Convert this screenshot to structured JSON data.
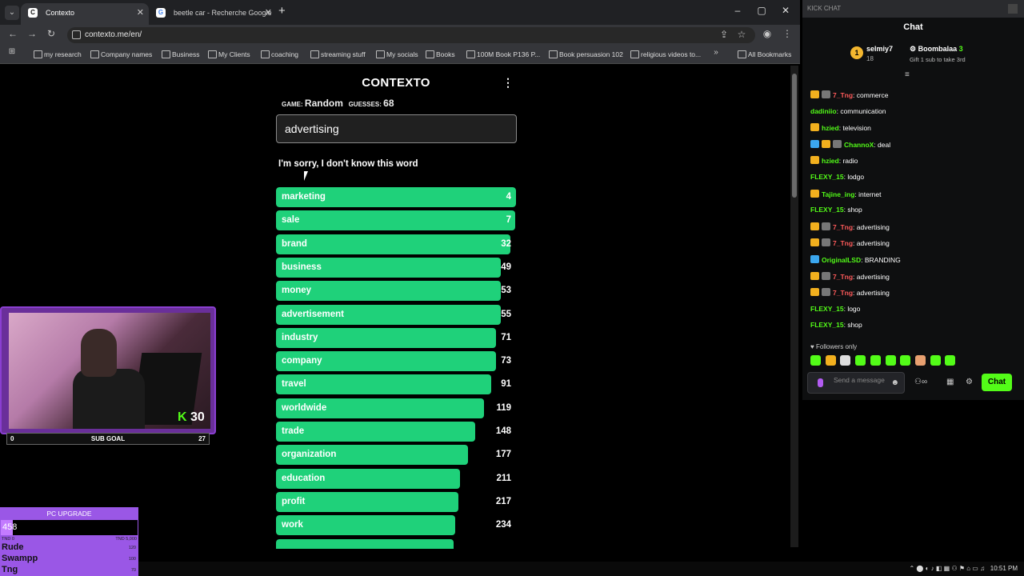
{
  "browser": {
    "tabs": [
      {
        "label": "Contexto",
        "active": true
      },
      {
        "label": "beetle car - Recherche Google",
        "active": false
      }
    ],
    "url": "contexto.me/en/",
    "bookmarks": [
      "my research",
      "Company names",
      "Business",
      "My Clients",
      "coaching",
      "streaming stuff",
      "My socials",
      "Books",
      "100M Book P136 P...",
      "Book persuasion 102",
      "religious videos to...",
      "All Bookmarks"
    ],
    "bookmarks_more": "»"
  },
  "contexto": {
    "title": "CONTEXTO",
    "game_label": "GAME:",
    "game_value": "Random",
    "guesses_label": "GUESSES:",
    "guesses_value": "68",
    "input_value": "advertising",
    "message": "I'm sorry, I don't know this word",
    "guesses": [
      {
        "word": "marketing",
        "rank": "4",
        "fill": 1.0
      },
      {
        "word": "sale",
        "rank": "7",
        "fill": 0.995
      },
      {
        "word": "brand",
        "rank": "32",
        "fill": 0.975
      },
      {
        "word": "business",
        "rank": "49",
        "fill": 0.935
      },
      {
        "word": "money",
        "rank": "53",
        "fill": 0.935
      },
      {
        "word": "advertisement",
        "rank": "55",
        "fill": 0.935
      },
      {
        "word": "industry",
        "rank": "71",
        "fill": 0.915
      },
      {
        "word": "company",
        "rank": "73",
        "fill": 0.915
      },
      {
        "word": "travel",
        "rank": "91",
        "fill": 0.895
      },
      {
        "word": "worldwide",
        "rank": "119",
        "fill": 0.865
      },
      {
        "word": "trade",
        "rank": "148",
        "fill": 0.83
      },
      {
        "word": "organization",
        "rank": "177",
        "fill": 0.8
      },
      {
        "word": "education",
        "rank": "211",
        "fill": 0.765
      },
      {
        "word": "profit",
        "rank": "217",
        "fill": 0.76
      },
      {
        "word": "work",
        "rank": "234",
        "fill": 0.745
      },
      {
        "word": "",
        "rank": "",
        "fill": 0.74
      }
    ]
  },
  "chat": {
    "window_label": "KICK CHAT",
    "title": "Chat",
    "pinned": {
      "user": "selmiy7",
      "count": "18",
      "gifter": "Boombalaa",
      "gift_count": "3",
      "gift_text": "Gift 1 sub to take 3rd"
    },
    "messages": [
      {
        "name": "7_Tng",
        "text": "commerce",
        "color": "#ff5a5a",
        "badges": [
          "gold",
          "grey"
        ]
      },
      {
        "name": "dadiniio",
        "text": "communication",
        "color": "#53fc18",
        "badges": []
      },
      {
        "name": "hzied",
        "text": "television",
        "color": "#53fc18",
        "badges": [
          "gold"
        ]
      },
      {
        "name": "ChannoX",
        "text": "deal",
        "color": "#53fc18",
        "badges": [
          "blue",
          "gold",
          "grey"
        ]
      },
      {
        "name": "hzied",
        "text": "radio",
        "color": "#53fc18",
        "badges": [
          "gold"
        ]
      },
      {
        "name": "FLEXY_15",
        "text": "lodgo",
        "color": "#53fc18",
        "badges": []
      },
      {
        "name": "Tajine_ing",
        "text": "internet",
        "color": "#53fc18",
        "badges": [
          "gold"
        ]
      },
      {
        "name": "FLEXY_15",
        "text": "shop",
        "color": "#53fc18",
        "badges": []
      },
      {
        "name": "7_Tng",
        "text": "advertising",
        "color": "#ff5a5a",
        "badges": [
          "gold",
          "grey"
        ]
      },
      {
        "name": "7_Tng",
        "text": "advertising",
        "color": "#ff5a5a",
        "badges": [
          "gold",
          "grey"
        ]
      },
      {
        "name": "OriginalLSD",
        "text": "BRANDING",
        "color": "#53fc18",
        "badges": [
          "blue"
        ]
      },
      {
        "name": "7_Tng",
        "text": "advertising",
        "color": "#ff5a5a",
        "badges": [
          "gold",
          "grey"
        ]
      },
      {
        "name": "7_Tng",
        "text": "advertising",
        "color": "#ff5a5a",
        "badges": [
          "gold",
          "grey"
        ]
      },
      {
        "name": "FLEXY_15",
        "text": "logo",
        "color": "#53fc18",
        "badges": []
      },
      {
        "name": "FLEXY_15",
        "text": "shop",
        "color": "#53fc18",
        "badges": []
      }
    ],
    "followers_only": "Followers only",
    "input_placeholder": "Send a message",
    "send_label": "Chat"
  },
  "stream": {
    "sub_goal_label": "SUB GOAL",
    "sub_goal_current": "0",
    "sub_goal_target": "27",
    "kick_count": "30",
    "pc_upgrade_title": "PC UPGRADE",
    "pc_upgrade_value": "458",
    "pc_upgrade_fill": 0.09,
    "pc_min": "TND 0",
    "pc_max": "TND 5,000",
    "donors": [
      {
        "name": "Rude",
        "amount": "120"
      },
      {
        "name": "Swampp",
        "amount": "100"
      },
      {
        "name": "Tng",
        "amount": "70"
      }
    ]
  },
  "taskbar": {
    "time": "10:51 PM"
  },
  "colors": {
    "bar_green": "#1fd17a",
    "kick_green": "#53fc18",
    "overlay_purple": "#9a57e6"
  }
}
